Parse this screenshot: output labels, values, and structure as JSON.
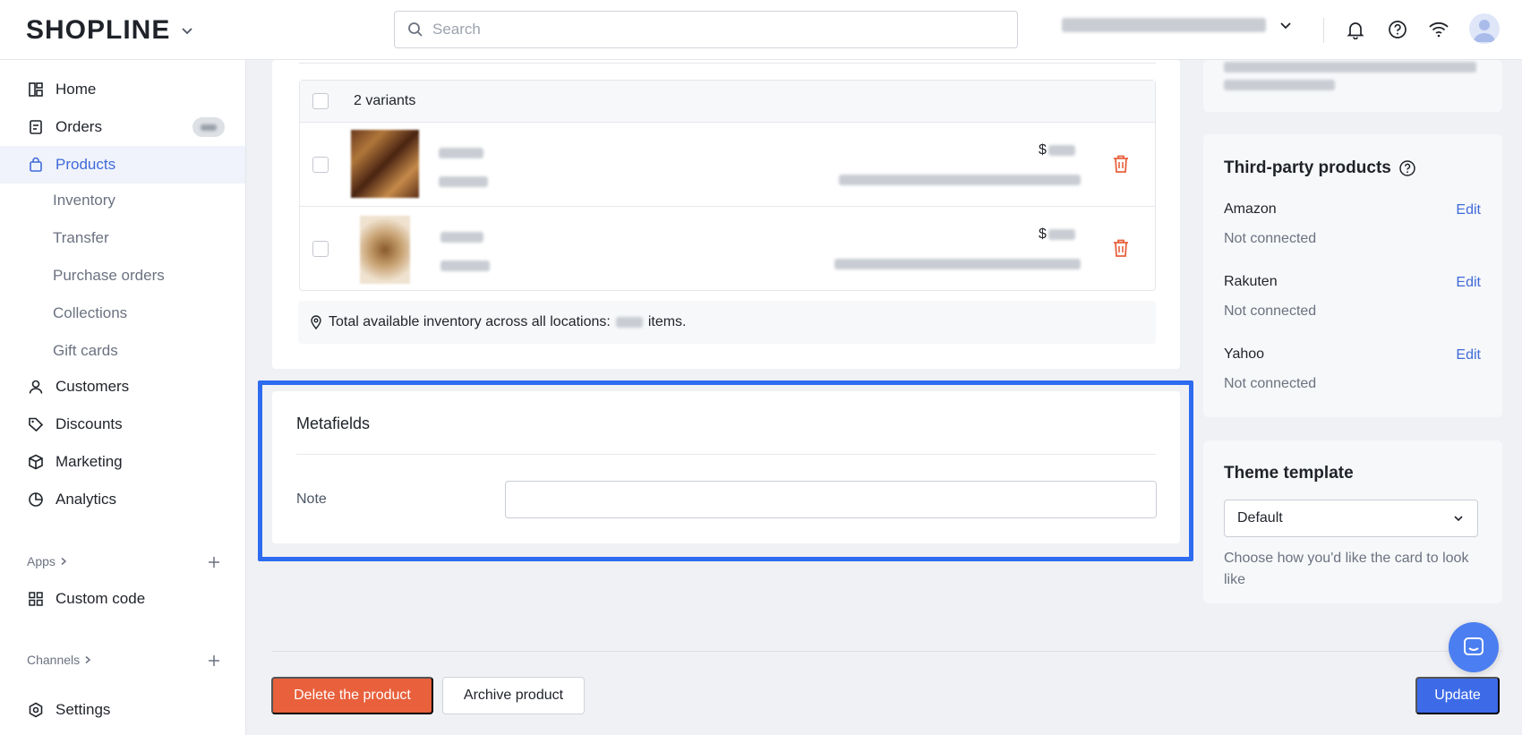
{
  "brand": {
    "logo_text": "SHOPLINE"
  },
  "search": {
    "placeholder": "Search"
  },
  "sidebar": {
    "items": [
      {
        "label": "Home",
        "icon": "home-icon"
      },
      {
        "label": "Orders",
        "icon": "orders-icon"
      },
      {
        "label": "Products",
        "icon": "bag-icon"
      },
      {
        "label": "Customers",
        "icon": "person-icon"
      },
      {
        "label": "Discounts",
        "icon": "tag-icon"
      },
      {
        "label": "Marketing",
        "icon": "cube-icon"
      },
      {
        "label": "Analytics",
        "icon": "pie-chart-icon"
      },
      {
        "label": "Custom code",
        "icon": "grid-icon"
      },
      {
        "label": "Settings",
        "icon": "gear-icon"
      }
    ],
    "product_subitems": [
      "Inventory",
      "Transfer",
      "Purchase orders",
      "Collections",
      "Gift cards"
    ],
    "apps_label": "Apps",
    "channels_label": "Channels"
  },
  "variants": {
    "header_label": "2 variants",
    "rows": [
      {
        "price_prefix": "$"
      },
      {
        "price_prefix": "$"
      }
    ],
    "inventory_prefix": "Total available inventory across all locations:",
    "inventory_suffix": "items."
  },
  "metafields": {
    "title": "Metafields",
    "note_label": "Note",
    "note_value": ""
  },
  "third_party": {
    "title": "Third-party products",
    "channels": [
      {
        "name": "Amazon",
        "status": "Not connected",
        "action": "Edit"
      },
      {
        "name": "Rakuten",
        "status": "Not connected",
        "action": "Edit"
      },
      {
        "name": "Yahoo",
        "status": "Not connected",
        "action": "Edit"
      }
    ]
  },
  "theme_template": {
    "title": "Theme template",
    "selected": "Default",
    "help": "Choose how you'd like the card to look like"
  },
  "footer": {
    "delete_label": "Delete the product",
    "archive_label": "Archive product",
    "update_label": "Update"
  },
  "colors": {
    "accent": "#3d6be8",
    "danger": "#e8603c",
    "highlight": "#2d6bf0"
  }
}
